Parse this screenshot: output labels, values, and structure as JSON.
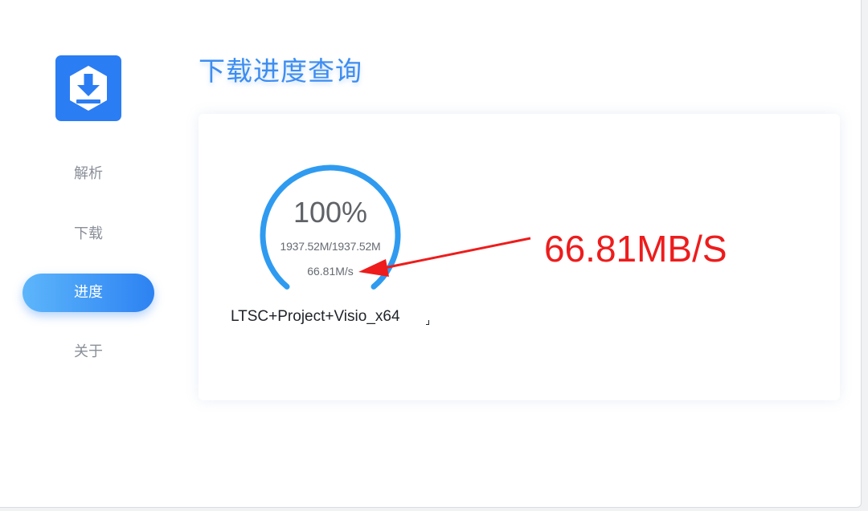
{
  "app": {
    "logo_icon": "download-icon",
    "accent_color": "#2b7df3"
  },
  "sidebar": {
    "items": [
      {
        "label": "解析",
        "active": false
      },
      {
        "label": "下载",
        "active": false
      },
      {
        "label": "进度",
        "active": true
      },
      {
        "label": "关于",
        "active": false
      }
    ]
  },
  "main": {
    "title": "下载进度查询",
    "progress": {
      "percent_text": "100%",
      "fraction": 1.0,
      "size_text": "1937.52M/1937.52M",
      "speed_text": "66.81M/s",
      "color": "#2f9bf0"
    },
    "file_name": "LTSC+Project+Visio_x64"
  },
  "annotation": {
    "text": "66.81MB/S",
    "color": "#ee1c1c"
  }
}
